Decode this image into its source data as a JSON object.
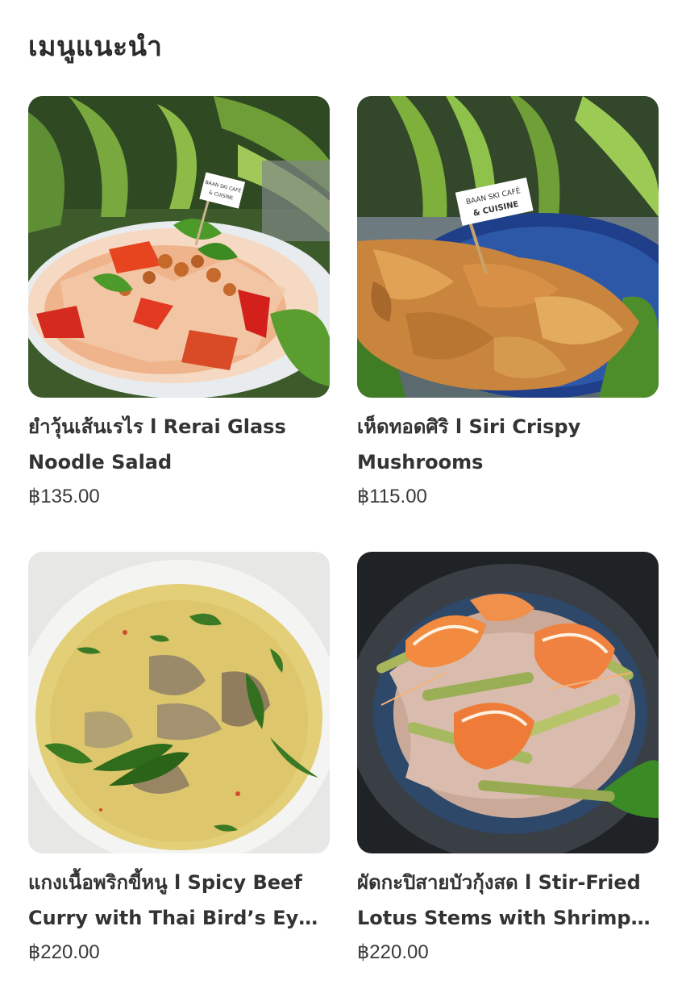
{
  "section": {
    "title": "เมนูแนะนำ"
  },
  "menu_items": [
    {
      "name": "ยำวุ้นเส้นเรไร l Rerai Glass Noodle Salad",
      "price": "฿135.00",
      "image": "glass-noodle-salad-photo",
      "flag_line1": "BAAN SKI CAFÉ",
      "flag_line2": "& CUISINE"
    },
    {
      "name": "เห็ดทอดศิริ l Siri Crispy Mushrooms",
      "price": "฿115.00",
      "image": "crispy-mushrooms-photo",
      "flag_line1": "BAAN SKI CAFÉ",
      "flag_line2": "& CUISINE"
    },
    {
      "name": "แกงเนื้อพริกขี้หนู l Spicy Beef Curry with Thai Bird’s Eye Chili",
      "price": "฿220.00",
      "image": "green-beef-curry-photo"
    },
    {
      "name": "ผัดกะปิสายบัวกุ้งสด l Stir-Fried Lotus Stems with Shrimp Paste and Fresh Prawns",
      "price": "฿220.00",
      "image": "lotus-stems-prawns-photo"
    }
  ]
}
